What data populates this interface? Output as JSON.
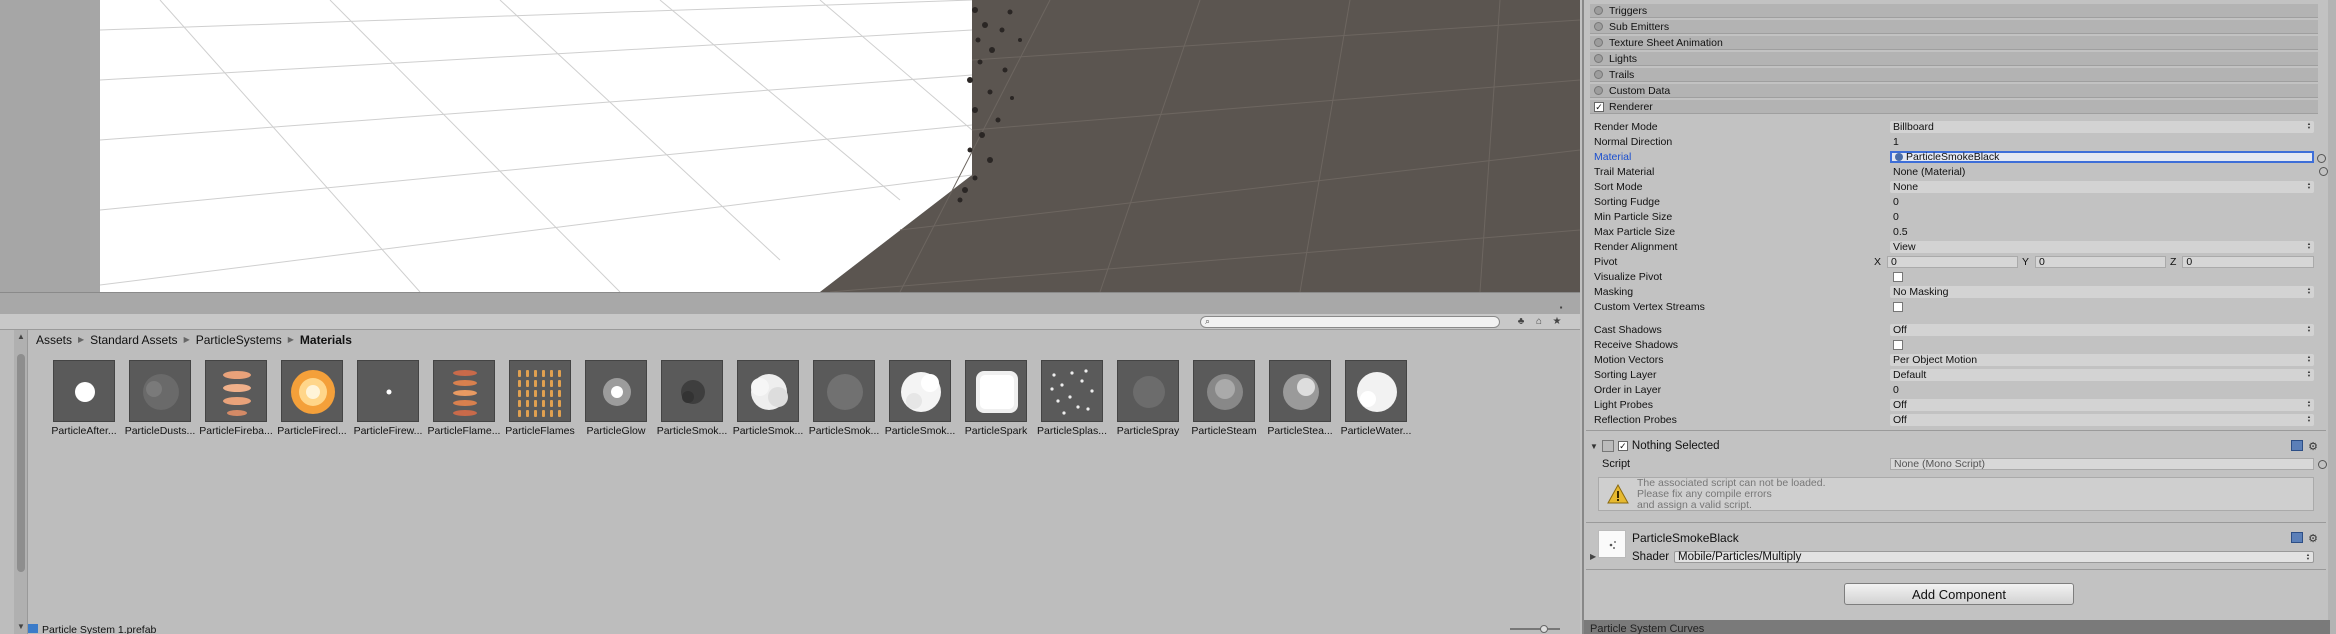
{
  "project": {
    "breadcrumb": [
      "Assets",
      "Standard Assets",
      "ParticleSystems",
      "Materials"
    ],
    "assets": [
      {
        "label": "ParticleAfter...",
        "icon": "afterburner-thumb"
      },
      {
        "label": "ParticleDusts...",
        "icon": "dust-thumb"
      },
      {
        "label": "ParticleFireba...",
        "icon": "fireball-thumb"
      },
      {
        "label": "ParticleFirecl...",
        "icon": "firecloud-thumb"
      },
      {
        "label": "ParticleFirew...",
        "icon": "firework-thumb"
      },
      {
        "label": "ParticleFlame...",
        "icon": "flame-thumb"
      },
      {
        "label": "ParticleFlames",
        "icon": "flames-thumb"
      },
      {
        "label": "ParticleGlow",
        "icon": "glow-thumb"
      },
      {
        "label": "ParticleSmok...",
        "icon": "smoke-black-thumb"
      },
      {
        "label": "ParticleSmok...",
        "icon": "smoke-white-thumb"
      },
      {
        "label": "ParticleSmok...",
        "icon": "smoke-grey-thumb"
      },
      {
        "label": "ParticleSmok...",
        "icon": "smoke-puff-thumb"
      },
      {
        "label": "ParticleSpark",
        "icon": "spark-thumb"
      },
      {
        "label": "ParticleSplas...",
        "icon": "splash-thumb"
      },
      {
        "label": "ParticleSpray",
        "icon": "spray-thumb"
      },
      {
        "label": "ParticleSteam",
        "icon": "steam-thumb"
      },
      {
        "label": "ParticleStea...",
        "icon": "steam-2-thumb"
      },
      {
        "label": "ParticleWater...",
        "icon": "water-thumb"
      }
    ],
    "status_file": "Particle System 1.prefab"
  },
  "inspector": {
    "modules": [
      {
        "label": "Triggers",
        "enabled": false
      },
      {
        "label": "Sub Emitters",
        "enabled": false
      },
      {
        "label": "Texture Sheet Animation",
        "enabled": false
      },
      {
        "label": "Lights",
        "enabled": false
      },
      {
        "label": "Trails",
        "enabled": false
      },
      {
        "label": "Custom Data",
        "enabled": false
      },
      {
        "label": "Renderer",
        "enabled": true
      }
    ],
    "renderer": {
      "render_mode_label": "Render Mode",
      "render_mode": "Billboard",
      "normal_direction_label": "Normal Direction",
      "normal_direction": "1",
      "material_label": "Material",
      "material": "ParticleSmokeBlack",
      "trail_material_label": "Trail Material",
      "trail_material": "None (Material)",
      "sort_mode_label": "Sort Mode",
      "sort_mode": "None",
      "sorting_fudge_label": "Sorting Fudge",
      "sorting_fudge": "0",
      "min_particle_size_label": "Min Particle Size",
      "min_particle_size": "0",
      "max_particle_size_label": "Max Particle Size",
      "max_particle_size": "0.5",
      "render_alignment_label": "Render Alignment",
      "render_alignment": "View",
      "pivot_label": "Pivot",
      "pivot_x_label": "X",
      "pivot_x": "0",
      "pivot_y_label": "Y",
      "pivot_y": "0",
      "pivot_z_label": "Z",
      "pivot_z": "0",
      "visualize_pivot_label": "Visualize Pivot",
      "masking_label": "Masking",
      "masking": "No Masking",
      "custom_vertex_streams_label": "Custom Vertex Streams",
      "cast_shadows_label": "Cast Shadows",
      "cast_shadows": "Off",
      "receive_shadows_label": "Receive Shadows",
      "motion_vectors_label": "Motion Vectors",
      "motion_vectors": "Per Object Motion",
      "sorting_layer_label": "Sorting Layer",
      "sorting_layer": "Default",
      "order_in_layer_label": "Order in Layer",
      "order_in_layer": "0",
      "light_probes_label": "Light Probes",
      "light_probes": "Off",
      "reflection_probes_label": "Reflection Probes",
      "reflection_probes": "Off"
    },
    "script_component": {
      "title": "Nothing Selected",
      "script_label": "Script",
      "script_value": "None (Mono Script)",
      "warning_lines": [
        "The associated script can not be loaded.",
        "Please fix any compile errors",
        "and assign a valid script."
      ]
    },
    "material_component": {
      "name": "ParticleSmokeBlack",
      "shader_label": "Shader",
      "shader_value": "Mobile/Particles/Multiply"
    },
    "add_component": "Add Component",
    "curves_label": "Particle System Curves"
  }
}
